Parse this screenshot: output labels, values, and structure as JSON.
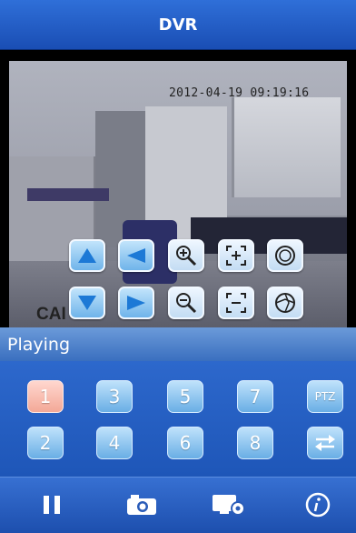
{
  "app": {
    "title": "DVR"
  },
  "video": {
    "timestamp": "2012-04-19 09:19:16",
    "camera_label": "CAI"
  },
  "ptz_controls": [
    {
      "name": "tilt-up",
      "icon": "arrow-up-icon"
    },
    {
      "name": "pan-left",
      "icon": "arrow-left-icon"
    },
    {
      "name": "zoom-in",
      "icon": "zoom-in-icon"
    },
    {
      "name": "focus-near",
      "icon": "focus-expand-icon"
    },
    {
      "name": "iris-open",
      "icon": "iris-open-icon"
    },
    {
      "name": "tilt-down",
      "icon": "arrow-down-icon"
    },
    {
      "name": "pan-right",
      "icon": "arrow-right-icon"
    },
    {
      "name": "zoom-out",
      "icon": "zoom-out-icon"
    },
    {
      "name": "focus-far",
      "icon": "focus-collapse-icon"
    },
    {
      "name": "iris-close",
      "icon": "iris-close-icon"
    }
  ],
  "status": {
    "text": "Playing"
  },
  "channels": {
    "row1": [
      "1",
      "3",
      "5",
      "7",
      "PTZ"
    ],
    "row2": [
      "2",
      "4",
      "6",
      "8"
    ],
    "active": "1",
    "switch_icon": "swap-arrows-icon"
  },
  "toolbar": {
    "items": [
      {
        "name": "pause",
        "icon": "pause-icon"
      },
      {
        "name": "snapshot",
        "icon": "camera-icon"
      },
      {
        "name": "settings",
        "icon": "monitor-gear-icon"
      },
      {
        "name": "info",
        "icon": "info-icon"
      }
    ]
  },
  "colors": {
    "title_bar": "#1a4eb4",
    "channel_button": "#69aee5",
    "channel_active": "#f3a897",
    "status_bar": "#3a6fbf"
  }
}
